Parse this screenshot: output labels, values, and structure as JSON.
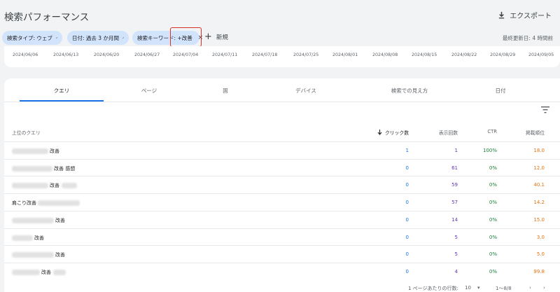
{
  "header": {
    "title": "検索パフォーマンス",
    "export_label": "エクスポート"
  },
  "filters": {
    "chips": [
      {
        "label": "検索タイプ: ウェブ"
      },
      {
        "label": "日付: 過去 3 か月間"
      },
      {
        "label": "検索キーワード: +改善"
      }
    ],
    "new_label": "新規",
    "last_updated": "最終更新日: 4 時間前"
  },
  "chart": {
    "dates": [
      "2024/06/06",
      "2024/06/13",
      "2024/06/20",
      "2024/06/27",
      "2024/07/04",
      "2024/07/11",
      "2024/07/18",
      "2024/07/25",
      "2024/08/01",
      "2024/08/08",
      "2024/08/15",
      "2024/08/22",
      "2024/08/29",
      "2024/09/05"
    ]
  },
  "tabs": [
    {
      "label": "クエリ",
      "active": true
    },
    {
      "label": "ページ"
    },
    {
      "label": "国"
    },
    {
      "label": "デバイス"
    },
    {
      "label": "検索での見え方"
    },
    {
      "label": "日付"
    }
  ],
  "table": {
    "headers": {
      "query": "上位のクエリ",
      "clicks": "クリック数",
      "impressions": "表示回数",
      "ctr": "CTR",
      "position": "掲載順位"
    },
    "rows": [
      {
        "query": "改善",
        "clicks": "1",
        "impressions": "1",
        "ctr": "100%",
        "position": "18.0"
      },
      {
        "query": "改善 感想",
        "clicks": "0",
        "impressions": "61",
        "ctr": "0%",
        "position": "12.0"
      },
      {
        "query": "改善",
        "clicks": "0",
        "impressions": "59",
        "ctr": "0%",
        "position": "40.1"
      },
      {
        "query": "肩こり改善",
        "clicks": "0",
        "impressions": "57",
        "ctr": "0%",
        "position": "14.2"
      },
      {
        "query": "改善",
        "clicks": "0",
        "impressions": "14",
        "ctr": "0%",
        "position": "15.0"
      },
      {
        "query": "改善",
        "clicks": "0",
        "impressions": "5",
        "ctr": "0%",
        "position": "3.0"
      },
      {
        "query": "改善",
        "clicks": "0",
        "impressions": "5",
        "ctr": "0%",
        "position": "5.0"
      },
      {
        "query": "改善",
        "clicks": "0",
        "impressions": "4",
        "ctr": "0%",
        "position": "99.8"
      }
    ]
  },
  "pagination": {
    "rows_per_page_label": "1 ページあたりの行数:",
    "rows_per_page": "10",
    "range": "1～8/8"
  },
  "colors": {
    "accent": "#1a73e8",
    "chip_bg": "#d2e3fc",
    "highlight_border": "#d93025",
    "impressions": "#5e35b1",
    "ctr": "#188038",
    "position": "#e8710a"
  }
}
